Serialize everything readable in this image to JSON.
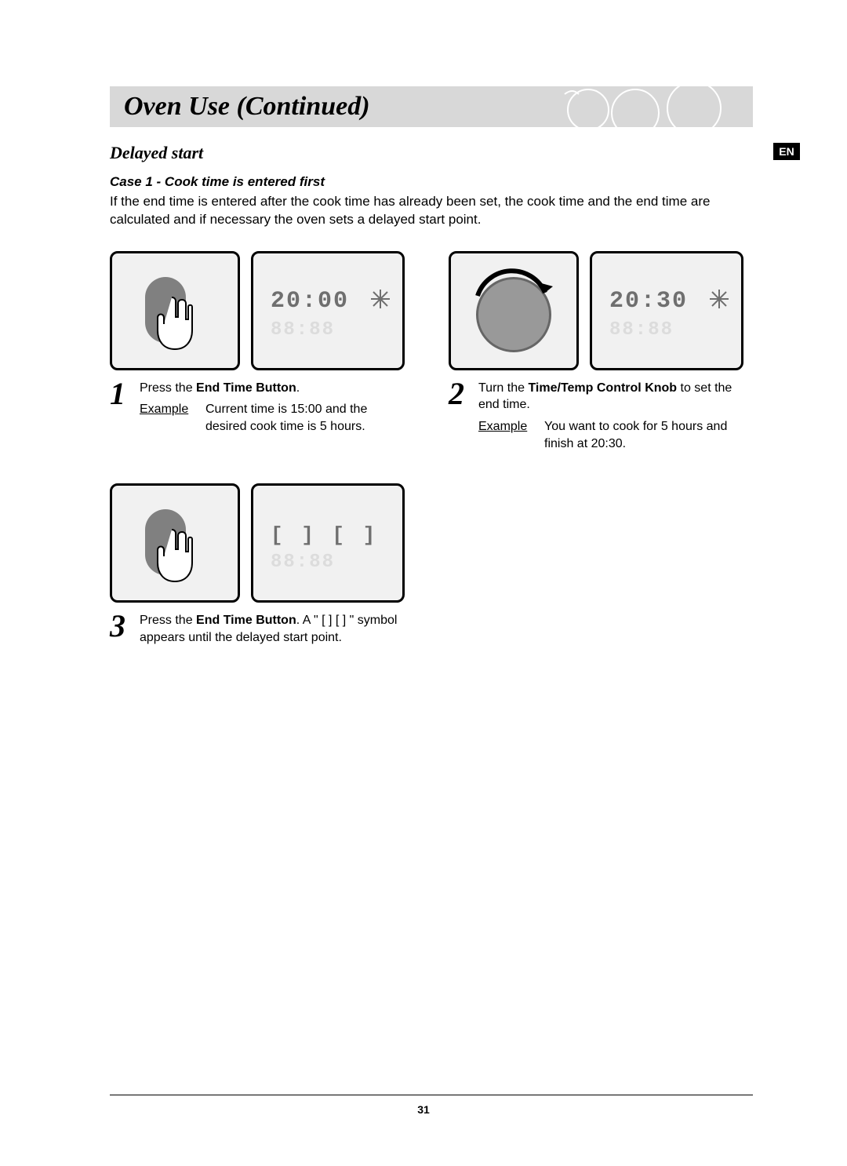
{
  "banner_title": "Oven Use (Continued)",
  "subsection_title": "Delayed start",
  "lang_tag": "EN",
  "case_title": "Case 1 - Cook time is entered first",
  "intro_text": "If the end time is entered after the cook time has already been set, the cook time and the end time are calculated and if necessary the oven sets a delayed start point.",
  "display1": "20:00",
  "display2": "20:30",
  "display3": "[ ] [ ]",
  "display_ghost": "88:88",
  "step1": {
    "num": "1",
    "action_pre": "Press the ",
    "action_bold": "End Time Button",
    "action_post": ".",
    "example_label": "Example",
    "example_text": "Current time is 15:00 and the desired cook time is 5 hours."
  },
  "step2": {
    "num": "2",
    "action_pre": "Turn the ",
    "action_bold": "Time/Temp Control Knob",
    "action_post": " to set the end time.",
    "example_label": "Example",
    "example_text": "You want to cook for 5 hours and finish at 20:30."
  },
  "step3": {
    "num": "3",
    "action_pre": "Press the ",
    "action_bold": "End Time Button",
    "action_post": ". A \" [ ] [ ] \" symbol appears until the delayed start point."
  },
  "page_number": "31"
}
